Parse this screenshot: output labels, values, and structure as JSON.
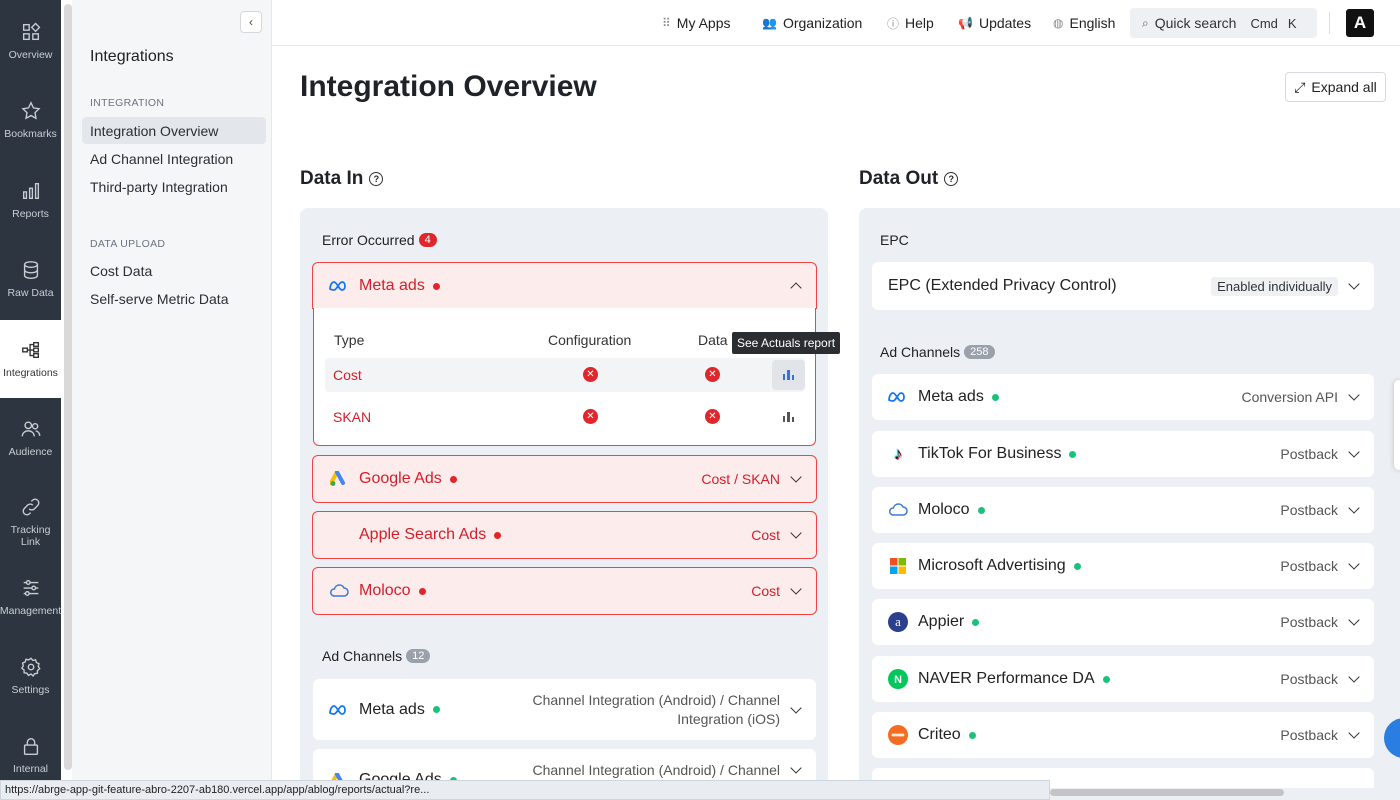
{
  "rail": {
    "items": [
      {
        "label": "Overview",
        "icon": "overview-icon"
      },
      {
        "label": "Bookmarks",
        "icon": "star-icon"
      },
      {
        "label": "Reports",
        "icon": "bar-chart-icon"
      },
      {
        "label": "Raw Data",
        "icon": "database-icon"
      },
      {
        "label": "Integrations",
        "icon": "integrations-icon"
      },
      {
        "label": "Audience",
        "icon": "users-icon"
      },
      {
        "label": "Tracking Link",
        "icon": "link-icon"
      },
      {
        "label": "Management",
        "icon": "sliders-icon"
      },
      {
        "label": "Settings",
        "icon": "gear-icon"
      },
      {
        "label": "Internal",
        "icon": "lock-icon"
      }
    ]
  },
  "sidebar": {
    "title": "Integrations",
    "section1": "INTEGRATION",
    "links1": [
      "Integration Overview",
      "Ad Channel Integration",
      "Third-party Integration"
    ],
    "section2": "DATA UPLOAD",
    "links2": [
      "Cost Data",
      "Self-serve Metric Data"
    ]
  },
  "topbar": {
    "my_apps": "My Apps",
    "organization": "Organization",
    "help": "Help",
    "updates": "Updates",
    "language": "English",
    "search_label": "Quick search",
    "search_cmd": "Cmd",
    "search_key": "K",
    "logo_letter": "A"
  },
  "page": {
    "title": "Integration Overview",
    "expand_all": "Expand all"
  },
  "data_in": {
    "title": "Data In",
    "error_label": "Error Occurred",
    "error_count": "4",
    "meta_name": "Meta ads",
    "table_headers": {
      "type": "Type",
      "configuration": "Configuration",
      "data": "Data"
    },
    "rows": [
      {
        "type": "Cost"
      },
      {
        "type": "SKAN"
      }
    ],
    "tooltip": "See Actuals report",
    "errors": [
      {
        "name": "Google Ads",
        "right": "Cost / SKAN"
      },
      {
        "name": "Apple Search Ads",
        "right": "Cost"
      },
      {
        "name": "Moloco",
        "right": "Cost"
      }
    ],
    "channels_label": "Ad Channels",
    "channels_count": "12",
    "channels": [
      {
        "name": "Meta ads",
        "right1": "Channel Integration (Android) / Channel",
        "right2": "Integration (iOS)"
      },
      {
        "name": "Google Ads",
        "right1": "Channel Integration (Android) / Channel"
      }
    ]
  },
  "data_out": {
    "title": "Data Out",
    "epc_label": "EPC",
    "epc_name": "EPC (Extended Privacy Control)",
    "epc_badge": "Enabled individually",
    "channels_label": "Ad Channels",
    "channels_count": "258",
    "channels": [
      {
        "name": "Meta ads",
        "right": "Conversion API"
      },
      {
        "name": "TikTok For Business",
        "right": "Postback"
      },
      {
        "name": "Moloco",
        "right": "Postback"
      },
      {
        "name": "Microsoft Advertising",
        "right": "Postback"
      },
      {
        "name": "Appier",
        "right": "Postback"
      },
      {
        "name": "NAVER Performance DA",
        "right": "Postback"
      },
      {
        "name": "Criteo",
        "right": "Postback"
      }
    ]
  },
  "statusbar": {
    "url": "https://abrge-app-git-feature-abro-2207-ab180.vercel.app/app/ablog/reports/actual?re..."
  },
  "colors": {
    "error": "#d4202a",
    "success": "#17c37b",
    "rail": "#2d3640",
    "accent": "#3d6fd8"
  }
}
